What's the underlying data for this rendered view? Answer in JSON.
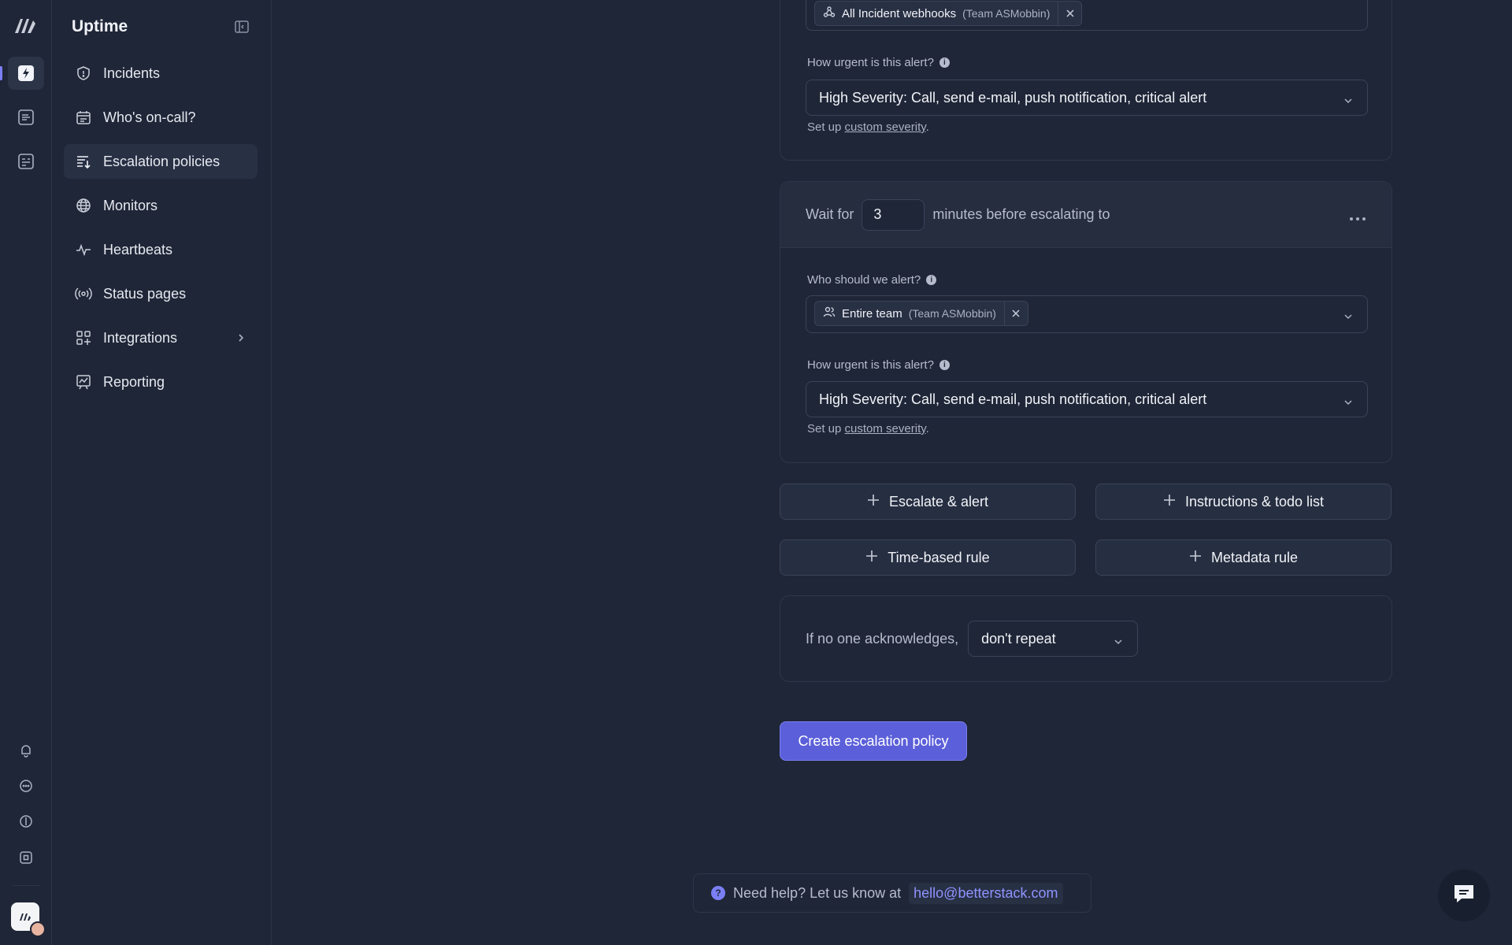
{
  "app": {
    "title": "Uptime"
  },
  "rail": {
    "icons": [
      "betterstack-logo-icon",
      "uptime-icon",
      "logs-icon",
      "dashboards-icon",
      "bell-icon",
      "chat-icon",
      "status-icon",
      "command-icon"
    ]
  },
  "sidebar": {
    "title": "Uptime",
    "items": [
      {
        "label": "Incidents",
        "icon": "shield-alert-icon"
      },
      {
        "label": "Who's on-call?",
        "icon": "calendar-icon"
      },
      {
        "label": "Escalation policies",
        "icon": "list-arrow-icon",
        "active": true
      },
      {
        "label": "Monitors",
        "icon": "globe-icon"
      },
      {
        "label": "Heartbeats",
        "icon": "pulse-icon"
      },
      {
        "label": "Status pages",
        "icon": "broadcast-icon"
      },
      {
        "label": "Integrations",
        "icon": "grid-plus-icon",
        "has_submenu": true
      },
      {
        "label": "Reporting",
        "icon": "chart-board-icon"
      }
    ]
  },
  "step1": {
    "tag": {
      "label": "All Incident webhooks",
      "team": "(Team ASMobbin)"
    },
    "urgency_label": "How urgent is this alert?",
    "urgency_value": "High Severity: Call, send e-mail, push notification, critical alert",
    "hint_prefix": "Set up ",
    "hint_link": "custom severity",
    "hint_suffix": "."
  },
  "step2": {
    "wait_prefix": "Wait for",
    "wait_value": "3",
    "wait_suffix": "minutes before escalating to",
    "who_label": "Who should we alert?",
    "tag": {
      "label": "Entire team",
      "team": "(Team ASMobbin)"
    },
    "urgency_label": "How urgent is this alert?",
    "urgency_value": "High Severity: Call, send e-mail, push notification, critical alert",
    "hint_prefix": "Set up ",
    "hint_link": "custom severity",
    "hint_suffix": "."
  },
  "actions": {
    "escalate": "Escalate & alert",
    "instructions": "Instructions & todo list",
    "time_rule": "Time-based rule",
    "metadata_rule": "Metadata rule"
  },
  "repeat": {
    "label": "If no one acknowledges,",
    "value": "don't repeat"
  },
  "submit": {
    "label": "Create escalation policy"
  },
  "help": {
    "text": "Need help? Let us know at",
    "email": "hello@betterstack.com"
  },
  "colors": {
    "background": "#1f2637",
    "accent": "#5b5fd9",
    "link": "#8f93ff"
  }
}
